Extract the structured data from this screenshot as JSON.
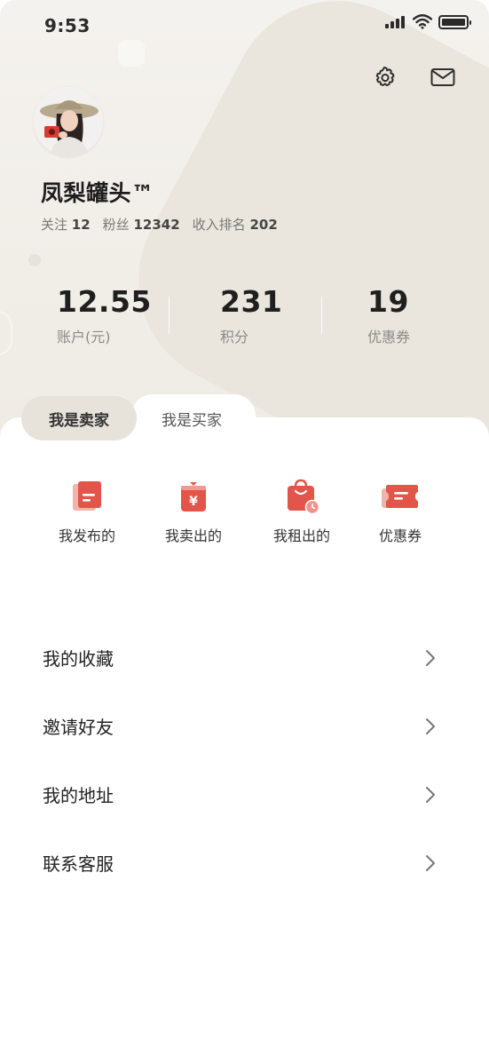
{
  "status_bar": {
    "time": "9:53"
  },
  "profile": {
    "username": "凤梨罐头™",
    "follow_label": "关注",
    "follow_count": "12",
    "fans_label": "粉丝",
    "fans_count": "12342",
    "rank_label": "收入排名",
    "rank_value": "202"
  },
  "stats": [
    {
      "value": "12.55",
      "label": "账户(元)"
    },
    {
      "value": "231",
      "label": "积分"
    },
    {
      "value": "19",
      "label": "优惠券"
    }
  ],
  "tabs": {
    "seller": "我是卖家",
    "buyer": "我是买家"
  },
  "quick_actions": [
    {
      "label": "我发布的",
      "icon": "document-icon"
    },
    {
      "label": "我卖出的",
      "icon": "yen-bag-icon"
    },
    {
      "label": "我租出的",
      "icon": "shopping-bag-clock-icon"
    },
    {
      "label": "优惠券",
      "icon": "ticket-icon"
    }
  ],
  "menu": [
    {
      "label": "我的收藏"
    },
    {
      "label": "邀请好友"
    },
    {
      "label": "我的地址"
    },
    {
      "label": "联系客服"
    }
  ],
  "colors": {
    "accent": "#e25548",
    "hero_bg": "#efebe4",
    "tab_active_bg": "#e8e3da"
  }
}
